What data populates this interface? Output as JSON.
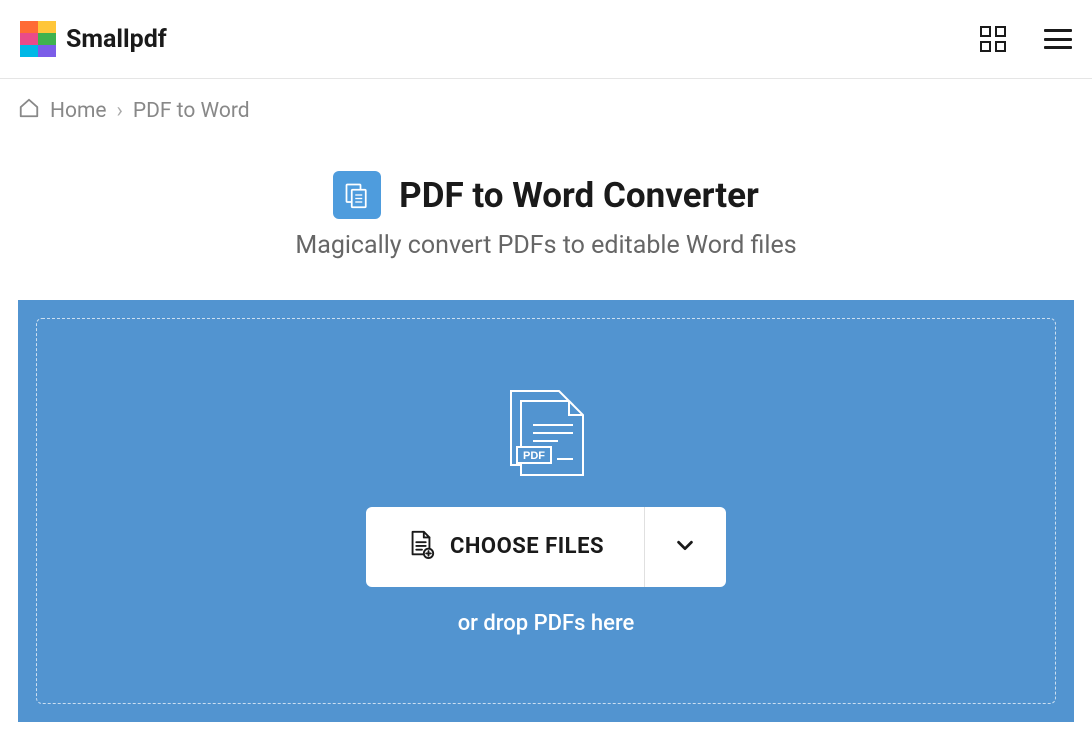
{
  "header": {
    "brand": "Smallpdf",
    "logo_colors": [
      "#ff6b35",
      "#ffc639",
      "#e94b8a",
      "#3fb24f",
      "#00b8e6",
      "#7b5de8"
    ]
  },
  "breadcrumb": {
    "home": "Home",
    "sep": "›",
    "current": "PDF to Word"
  },
  "title": {
    "heading": "PDF to Word Converter",
    "subtitle": "Magically convert PDFs to editable Word files"
  },
  "dropzone": {
    "choose_label": "CHOOSE FILES",
    "drop_text": "or drop PDFs here"
  },
  "colors": {
    "accent": "#5294d0",
    "tool_icon_bg": "#4e9cdd"
  }
}
